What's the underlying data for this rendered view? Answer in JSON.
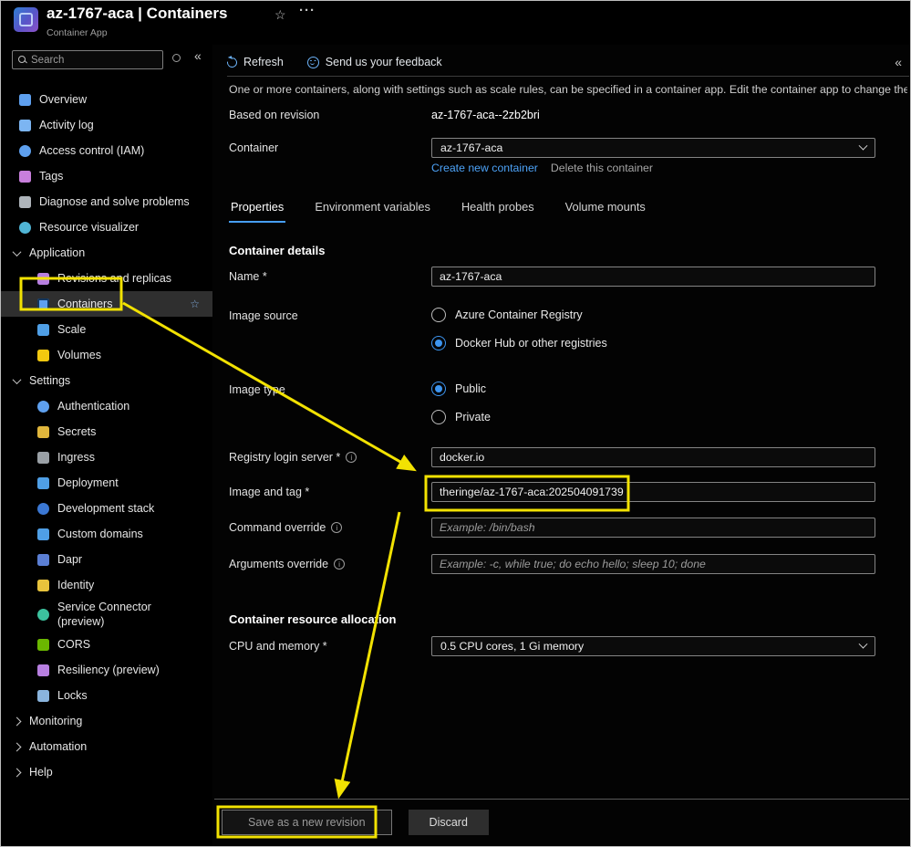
{
  "colors": {
    "accent": "#479ef5",
    "link": "#4da3f8",
    "annotation": "#f2e202",
    "radio_selected": "#3d95f0"
  },
  "icons": {
    "star": "☆",
    "ellipsis": "···",
    "collapse": "«"
  },
  "header": {
    "title": "az-1767-aca | Containers",
    "subtitle": "Container App"
  },
  "sidebar": {
    "search_placeholder": "Search",
    "items": [
      {
        "label": "Overview"
      },
      {
        "label": "Activity log"
      },
      {
        "label": "Access control (IAM)"
      },
      {
        "label": "Tags"
      },
      {
        "label": "Diagnose and solve problems"
      },
      {
        "label": "Resource visualizer"
      },
      {
        "label": "Application"
      },
      {
        "label": "Revisions and replicas"
      },
      {
        "label": "Containers"
      },
      {
        "label": "Scale"
      },
      {
        "label": "Volumes"
      },
      {
        "label": "Settings"
      },
      {
        "label": "Authentication"
      },
      {
        "label": "Secrets"
      },
      {
        "label": "Ingress"
      },
      {
        "label": "Deployment"
      },
      {
        "label": "Development stack"
      },
      {
        "label": "Custom domains"
      },
      {
        "label": "Dapr"
      },
      {
        "label": "Identity"
      },
      {
        "label": "Service Connector (preview)"
      },
      {
        "label": "CORS"
      },
      {
        "label": "Resiliency (preview)"
      },
      {
        "label": "Locks"
      },
      {
        "label": "Monitoring"
      },
      {
        "label": "Automation"
      },
      {
        "label": "Help"
      }
    ]
  },
  "toolbar": {
    "refresh": "Refresh",
    "feedback": "Send us your feedback"
  },
  "content": {
    "description": "One or more containers, along with settings such as scale rules, can be specified in a container app. Edit the container app to change the config",
    "based_on_revision": {
      "label": "Based on revision",
      "value": "az-1767-aca--2zb2bri"
    },
    "container": {
      "label": "Container",
      "value": "az-1767-aca"
    },
    "links": {
      "create": "Create new container",
      "delete": "Delete this container"
    },
    "tabs": [
      "Properties",
      "Environment variables",
      "Health probes",
      "Volume mounts"
    ],
    "sections": {
      "details": "Container details",
      "allocation": "Container resource allocation"
    },
    "fields": {
      "name": {
        "label": "Name *",
        "value": "az-1767-aca"
      },
      "image_source": {
        "label": "Image source",
        "options": [
          "Azure Container Registry",
          "Docker Hub or other registries"
        ],
        "selected": "Docker Hub or other registries"
      },
      "image_type": {
        "label": "Image type",
        "options": [
          "Public",
          "Private"
        ],
        "selected": "Public"
      },
      "registry_login_server": {
        "label": "Registry login server *",
        "value": "docker.io"
      },
      "image_and_tag": {
        "label": "Image and tag *",
        "value": "theringe/az-1767-aca:202504091739"
      },
      "command_override": {
        "label": "Command override",
        "placeholder": "Example: /bin/bash"
      },
      "arguments_override": {
        "label": "Arguments override",
        "placeholder": "Example: -c, while true; do echo hello; sleep 10; done"
      },
      "cpu_memory": {
        "label": "CPU and memory *",
        "value": "0.5 CPU cores, 1 Gi memory"
      }
    }
  },
  "footer": {
    "save": "Save as a new revision",
    "discard": "Discard"
  }
}
